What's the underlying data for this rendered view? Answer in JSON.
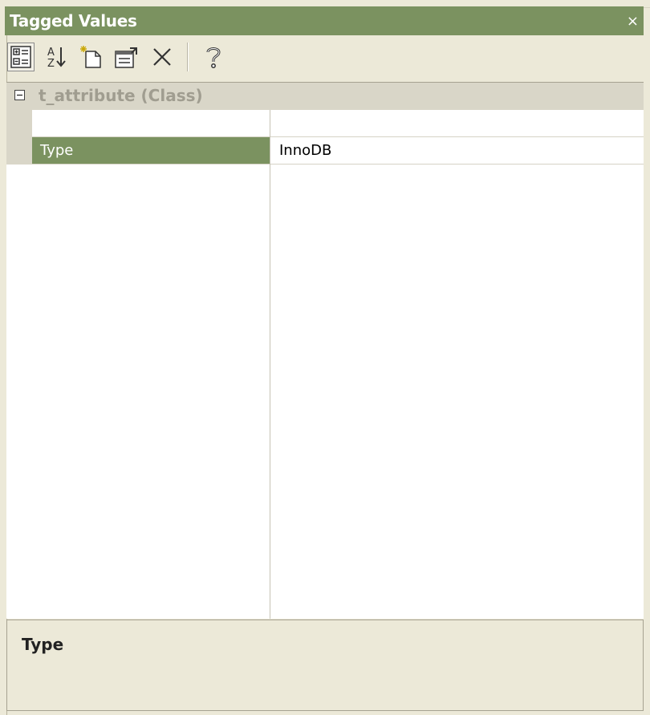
{
  "window": {
    "title": "Tagged Values",
    "close_glyph": "×"
  },
  "toolbar": {
    "buttons": [
      {
        "icon": "categorized-view-icon",
        "pressed": true
      },
      {
        "icon": "sort-alphabetical-icon",
        "pressed": false
      },
      {
        "icon": "new-tag-icon",
        "pressed": false
      },
      {
        "icon": "properties-icon",
        "pressed": false
      },
      {
        "icon": "delete-icon",
        "pressed": false
      },
      {
        "icon": "help-icon",
        "pressed": false
      }
    ]
  },
  "grid": {
    "category": {
      "label": "t_attribute (Class)",
      "expanded": true
    },
    "rows": [
      {
        "name": "",
        "value": ""
      },
      {
        "name": "Type",
        "value": "InnoDB",
        "selected": true
      }
    ]
  },
  "description": {
    "title": "Type"
  },
  "colors": {
    "accent": "#7b9260",
    "panel_bg": "#ece9d8"
  }
}
